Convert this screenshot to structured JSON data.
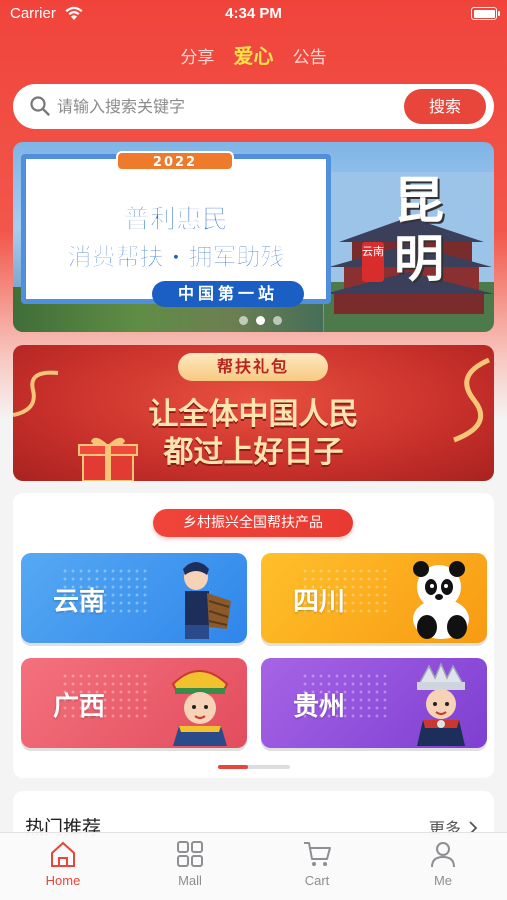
{
  "status_bar": {
    "carrier": "Carrier",
    "time": "4:34 PM"
  },
  "top_tabs": [
    {
      "label": "分享",
      "active": false
    },
    {
      "label": "爱心",
      "active": true
    },
    {
      "label": "公告",
      "active": false
    }
  ],
  "search": {
    "placeholder": "请输入搜索关键字",
    "button_label": "搜索"
  },
  "banner1": {
    "year": "2022",
    "line1": "普利惠民",
    "line2": "消费帮扶 · 拥军助残",
    "station": "中国第一站",
    "city": "昆明",
    "province": "云南",
    "dots": 3,
    "active_dot": 1
  },
  "banner2": {
    "tag": "帮扶礼包",
    "line1": "让全体中国人民",
    "line2": "都过上好日子"
  },
  "categories": {
    "title": "乡村振兴全国帮扶产品",
    "tiles": [
      {
        "label": "云南",
        "color": "#3a8ff0"
      },
      {
        "label": "四川",
        "color": "#fbad1c"
      },
      {
        "label": "广西",
        "color": "#ea5b6b"
      },
      {
        "label": "贵州",
        "color": "#8e4bdb"
      }
    ]
  },
  "hot": {
    "title": "热门推荐",
    "more": "更多"
  },
  "tabbar": {
    "items": [
      {
        "label": "Home",
        "icon": "home-icon",
        "active": true
      },
      {
        "label": "Mall",
        "icon": "grid-icon",
        "active": false
      },
      {
        "label": "Cart",
        "icon": "cart-icon",
        "active": false
      },
      {
        "label": "Me",
        "icon": "person-icon",
        "active": false
      }
    ]
  },
  "colors": {
    "accent": "#e8463b",
    "highlight": "#ffe14a"
  }
}
